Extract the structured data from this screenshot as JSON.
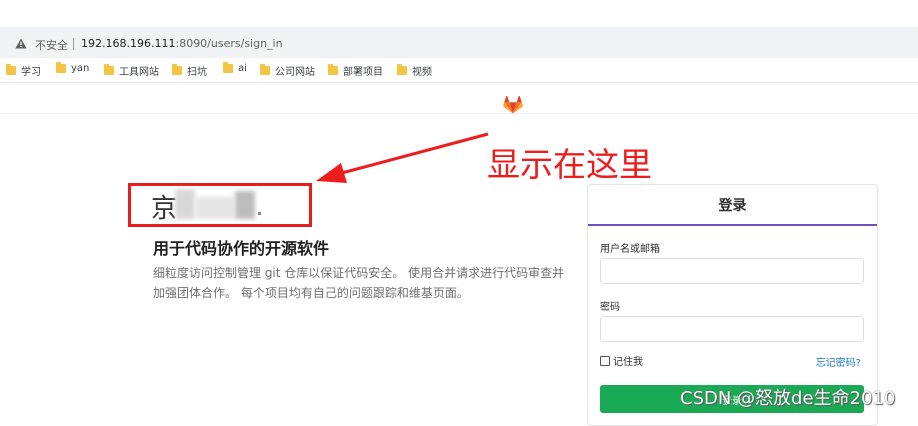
{
  "browser": {
    "insecure_label": "不安全",
    "url_host": "192.168.196.111",
    "url_rest": ":8090/users/sign_in"
  },
  "bookmarks": [
    {
      "label": "学习"
    },
    {
      "label": "yan"
    },
    {
      "label": "工具网站"
    },
    {
      "label": "扫坑"
    },
    {
      "label": "ai"
    },
    {
      "label": "公司网站"
    },
    {
      "label": "部署项目"
    },
    {
      "label": "视频"
    }
  ],
  "annotation": {
    "text": "显示在这里",
    "color": "#ee1d1d"
  },
  "brand": {
    "visible_char": "京"
  },
  "intro": {
    "tagline": "用于代码协作的开源软件",
    "description": "细粒度访问控制管理 git 仓库以保证代码安全。 使用合并请求进行代码审查并加强团体合作。 每个项目均有自己的问题跟踪和维基页面。"
  },
  "login": {
    "title": "登录",
    "username_label": "用户名或邮箱",
    "username_value": "",
    "password_label": "密码",
    "password_value": "",
    "remember_label": "记住我",
    "forgot_label": "忘记密码?",
    "submit_label": "登录",
    "accent_color": "#6b4fbb",
    "submit_color": "#1aaa55"
  },
  "watermark": "CSDN @怒放de生命2010"
}
